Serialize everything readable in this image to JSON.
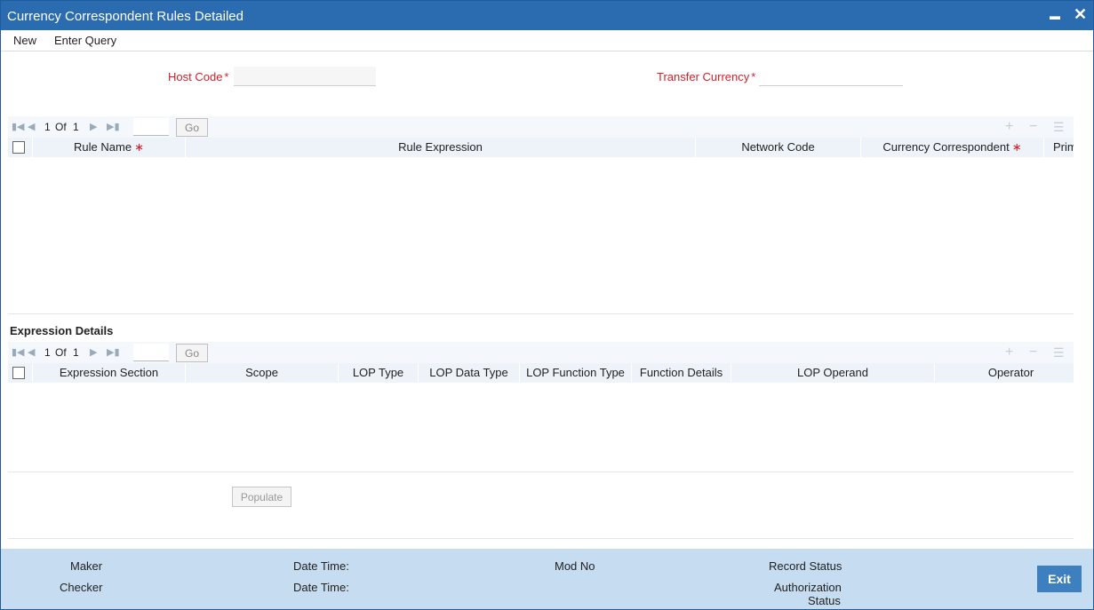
{
  "window": {
    "title": "Currency Correspondent Rules Detailed",
    "minimize_glyph": "▬",
    "close_glyph": "✕"
  },
  "menu": {
    "new": "New",
    "enter_query": "Enter Query"
  },
  "form": {
    "host_code_label": "Host Code",
    "host_code_value": "",
    "transfer_currency_label": "Transfer Currency",
    "transfer_currency_value": "",
    "required_mark": "*"
  },
  "rules_grid": {
    "pager": {
      "current": "1",
      "of_label": "Of",
      "total": "1",
      "go_label": "Go"
    },
    "columns": [
      {
        "label": "Rule Name",
        "required": true
      },
      {
        "label": "Rule Expression",
        "required": false
      },
      {
        "label": "Network Code",
        "required": false
      },
      {
        "label": "Currency Correspondent",
        "required": true
      },
      {
        "label": "Prim",
        "required": false
      }
    ],
    "required_mark": "∗"
  },
  "expression_details": {
    "title": "Expression Details",
    "pager": {
      "current": "1",
      "of_label": "Of",
      "total": "1",
      "go_label": "Go"
    },
    "columns": [
      "Expression Section",
      "Scope",
      "LOP Type",
      "LOP Data Type",
      "LOP Function Type",
      "Function Details",
      "LOP Operand",
      "Operator"
    ]
  },
  "populate_label": "Populate",
  "footer": {
    "maker": "Maker",
    "checker": "Checker",
    "date_time_1": "Date Time:",
    "date_time_2": "Date Time:",
    "mod_no": "Mod No",
    "record_status": "Record Status",
    "authorization_status_line1": "Authorization",
    "authorization_status_line2": "Status",
    "exit_label": "Exit"
  },
  "icons": {
    "first": "first-page-icon",
    "prev": "prev-page-icon",
    "next": "next-page-icon",
    "last": "last-page-icon",
    "add": "add-row-icon",
    "delete": "delete-row-icon",
    "view": "single-view-icon"
  },
  "colors": {
    "title_bar": "#2b6cb0",
    "required": "#d3202d",
    "footer": "#c6dcf0",
    "exit_button": "#3e7fc0"
  }
}
